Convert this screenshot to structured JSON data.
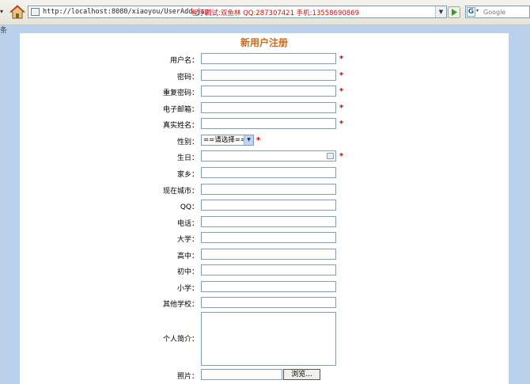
{
  "browser": {
    "url": "http://localhost:8080/xiaoyou/UserAdd.jsp",
    "debug_text": "程序调试:双鱼林 QQ:287307421 手机:13558690869",
    "search_placeholder": "Google",
    "search_logo": "G",
    "status_glyph": "条"
  },
  "form": {
    "title": "新用户注册",
    "required_mark": "*",
    "fields": {
      "username": "用户名：",
      "password": "密码：",
      "password2": "重复密码：",
      "email": "电子邮箱：",
      "realname": "真实姓名：",
      "gender": "性别：",
      "birthday": "生日：",
      "hometown": "家乡：",
      "city": "现在城市：",
      "qq": "QQ：",
      "phone": "电话：",
      "university": "大学：",
      "highschool": "高中：",
      "middleschool": "初中：",
      "primaryschool": "小学：",
      "otherschool": "其他学校：",
      "intro": "个人简介：",
      "photo": "照片："
    },
    "gender_selected": "==请选择==",
    "browse_label": "浏览..."
  }
}
